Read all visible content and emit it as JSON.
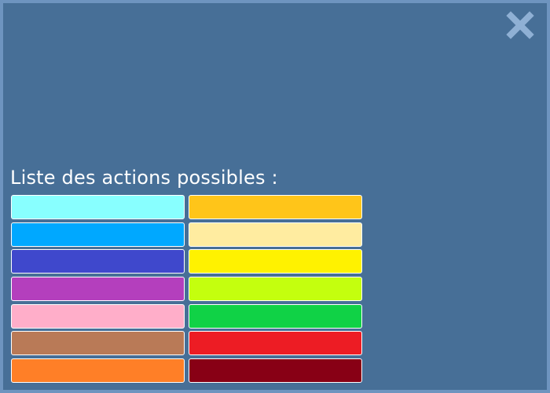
{
  "title": "Liste des actions possibles :",
  "close": {
    "icon": "close-icon",
    "color": "#8fb0d4"
  },
  "colors": {
    "background": "#476f97",
    "border": "#6e94bf"
  },
  "actions": [
    {
      "color": "#88ffff"
    },
    {
      "color": "#ffc519"
    },
    {
      "color": "#00a8ff"
    },
    {
      "color": "#ffeca0"
    },
    {
      "color": "#3f48cc"
    },
    {
      "color": "#fff200"
    },
    {
      "color": "#b43fbd"
    },
    {
      "color": "#c4ff0e"
    },
    {
      "color": "#ffaec9"
    },
    {
      "color": "#10d246"
    },
    {
      "color": "#b97a57"
    },
    {
      "color": "#ed1c24"
    },
    {
      "color": "#ff7f27"
    },
    {
      "color": "#880015"
    }
  ]
}
